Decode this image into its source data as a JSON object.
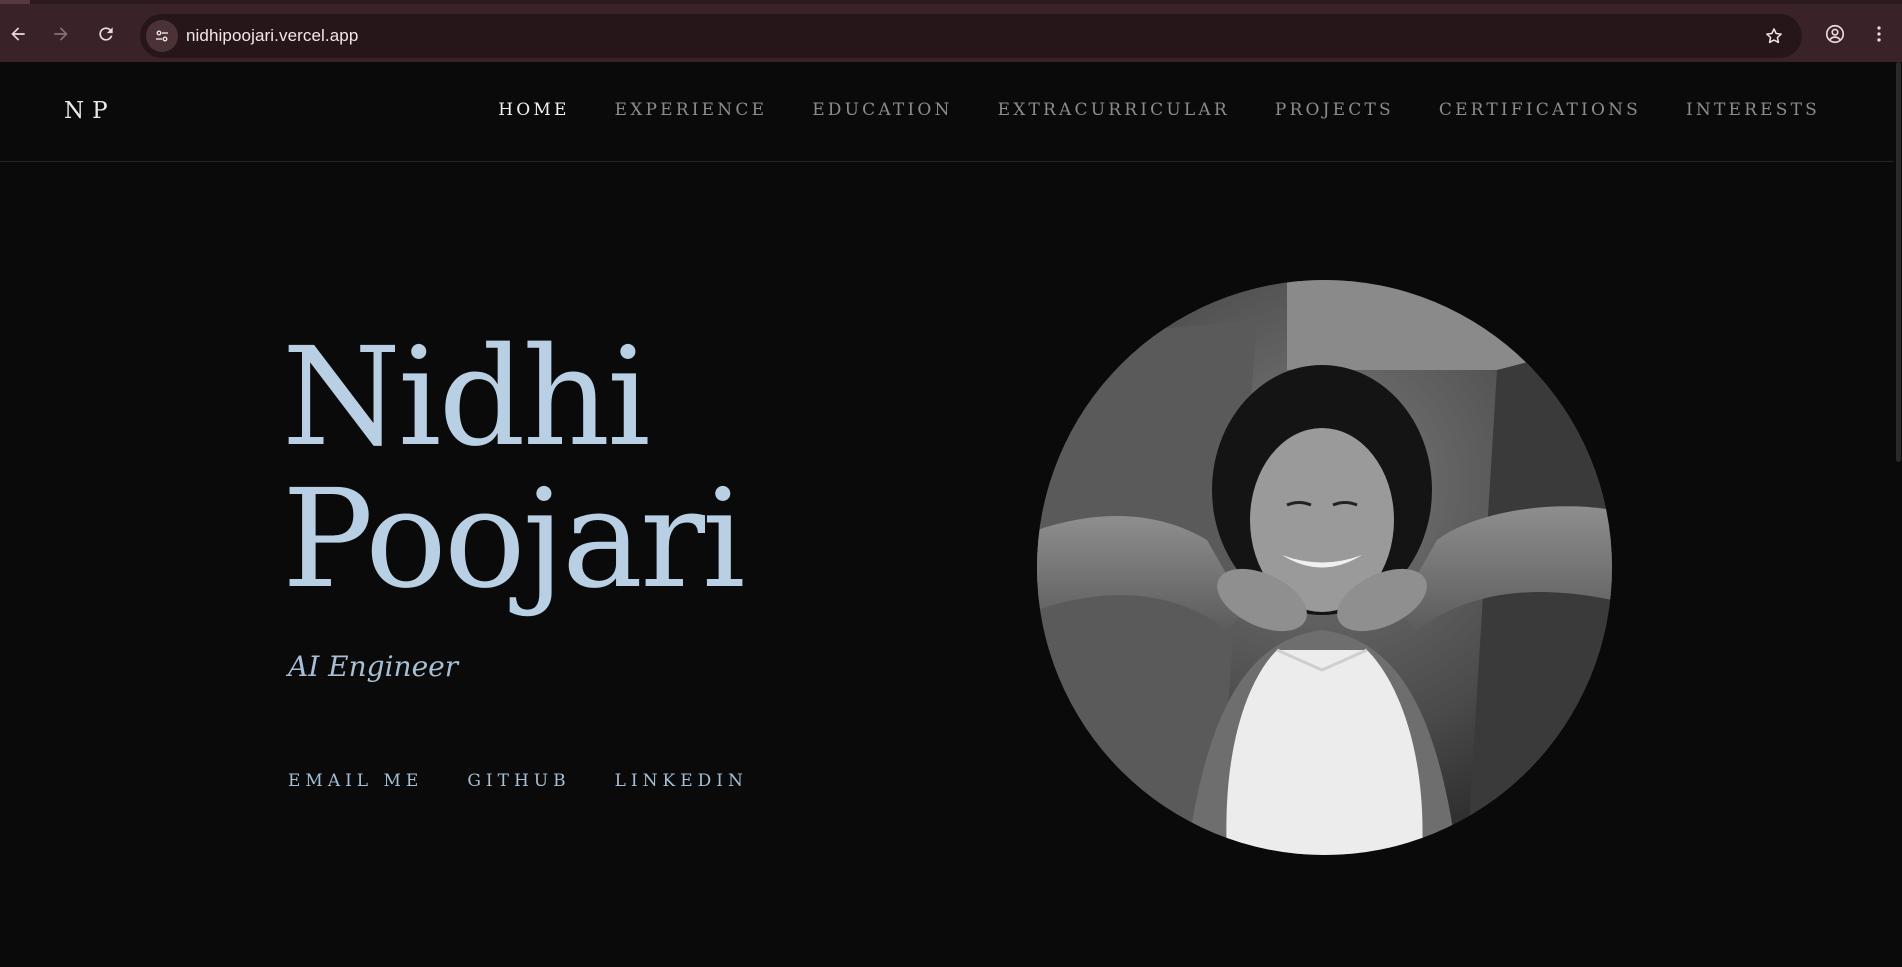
{
  "browser": {
    "url": "nidhipoojari.vercel.app",
    "icons": {
      "back": "arrow-left-icon",
      "forward": "arrow-right-icon",
      "reload": "reload-icon",
      "site_info": "tune-icon",
      "bookmark": "star-icon",
      "profile": "account-circle-icon",
      "menu": "more-vert-icon"
    },
    "colors": {
      "chrome": "#3a2328",
      "omnibox": "#26161a"
    }
  },
  "header": {
    "logo": "NP",
    "nav": [
      {
        "label": "HOME",
        "active": true
      },
      {
        "label": "EXPERIENCE",
        "active": false
      },
      {
        "label": "EDUCATION",
        "active": false
      },
      {
        "label": "EXTRACURRICULAR",
        "active": false
      },
      {
        "label": "PROJECTS",
        "active": false
      },
      {
        "label": "CERTIFICATIONS",
        "active": false
      },
      {
        "label": "INTERESTS",
        "active": false
      }
    ]
  },
  "hero": {
    "first_name": "Nidhi",
    "last_name": "Poojari",
    "role": "AI Engineer",
    "links": [
      {
        "label": "EMAIL ME"
      },
      {
        "label": "GITHUB"
      },
      {
        "label": "LINKEDIN"
      }
    ],
    "accent_color": "#b9d0e4",
    "background_color": "#0a0a0b"
  }
}
